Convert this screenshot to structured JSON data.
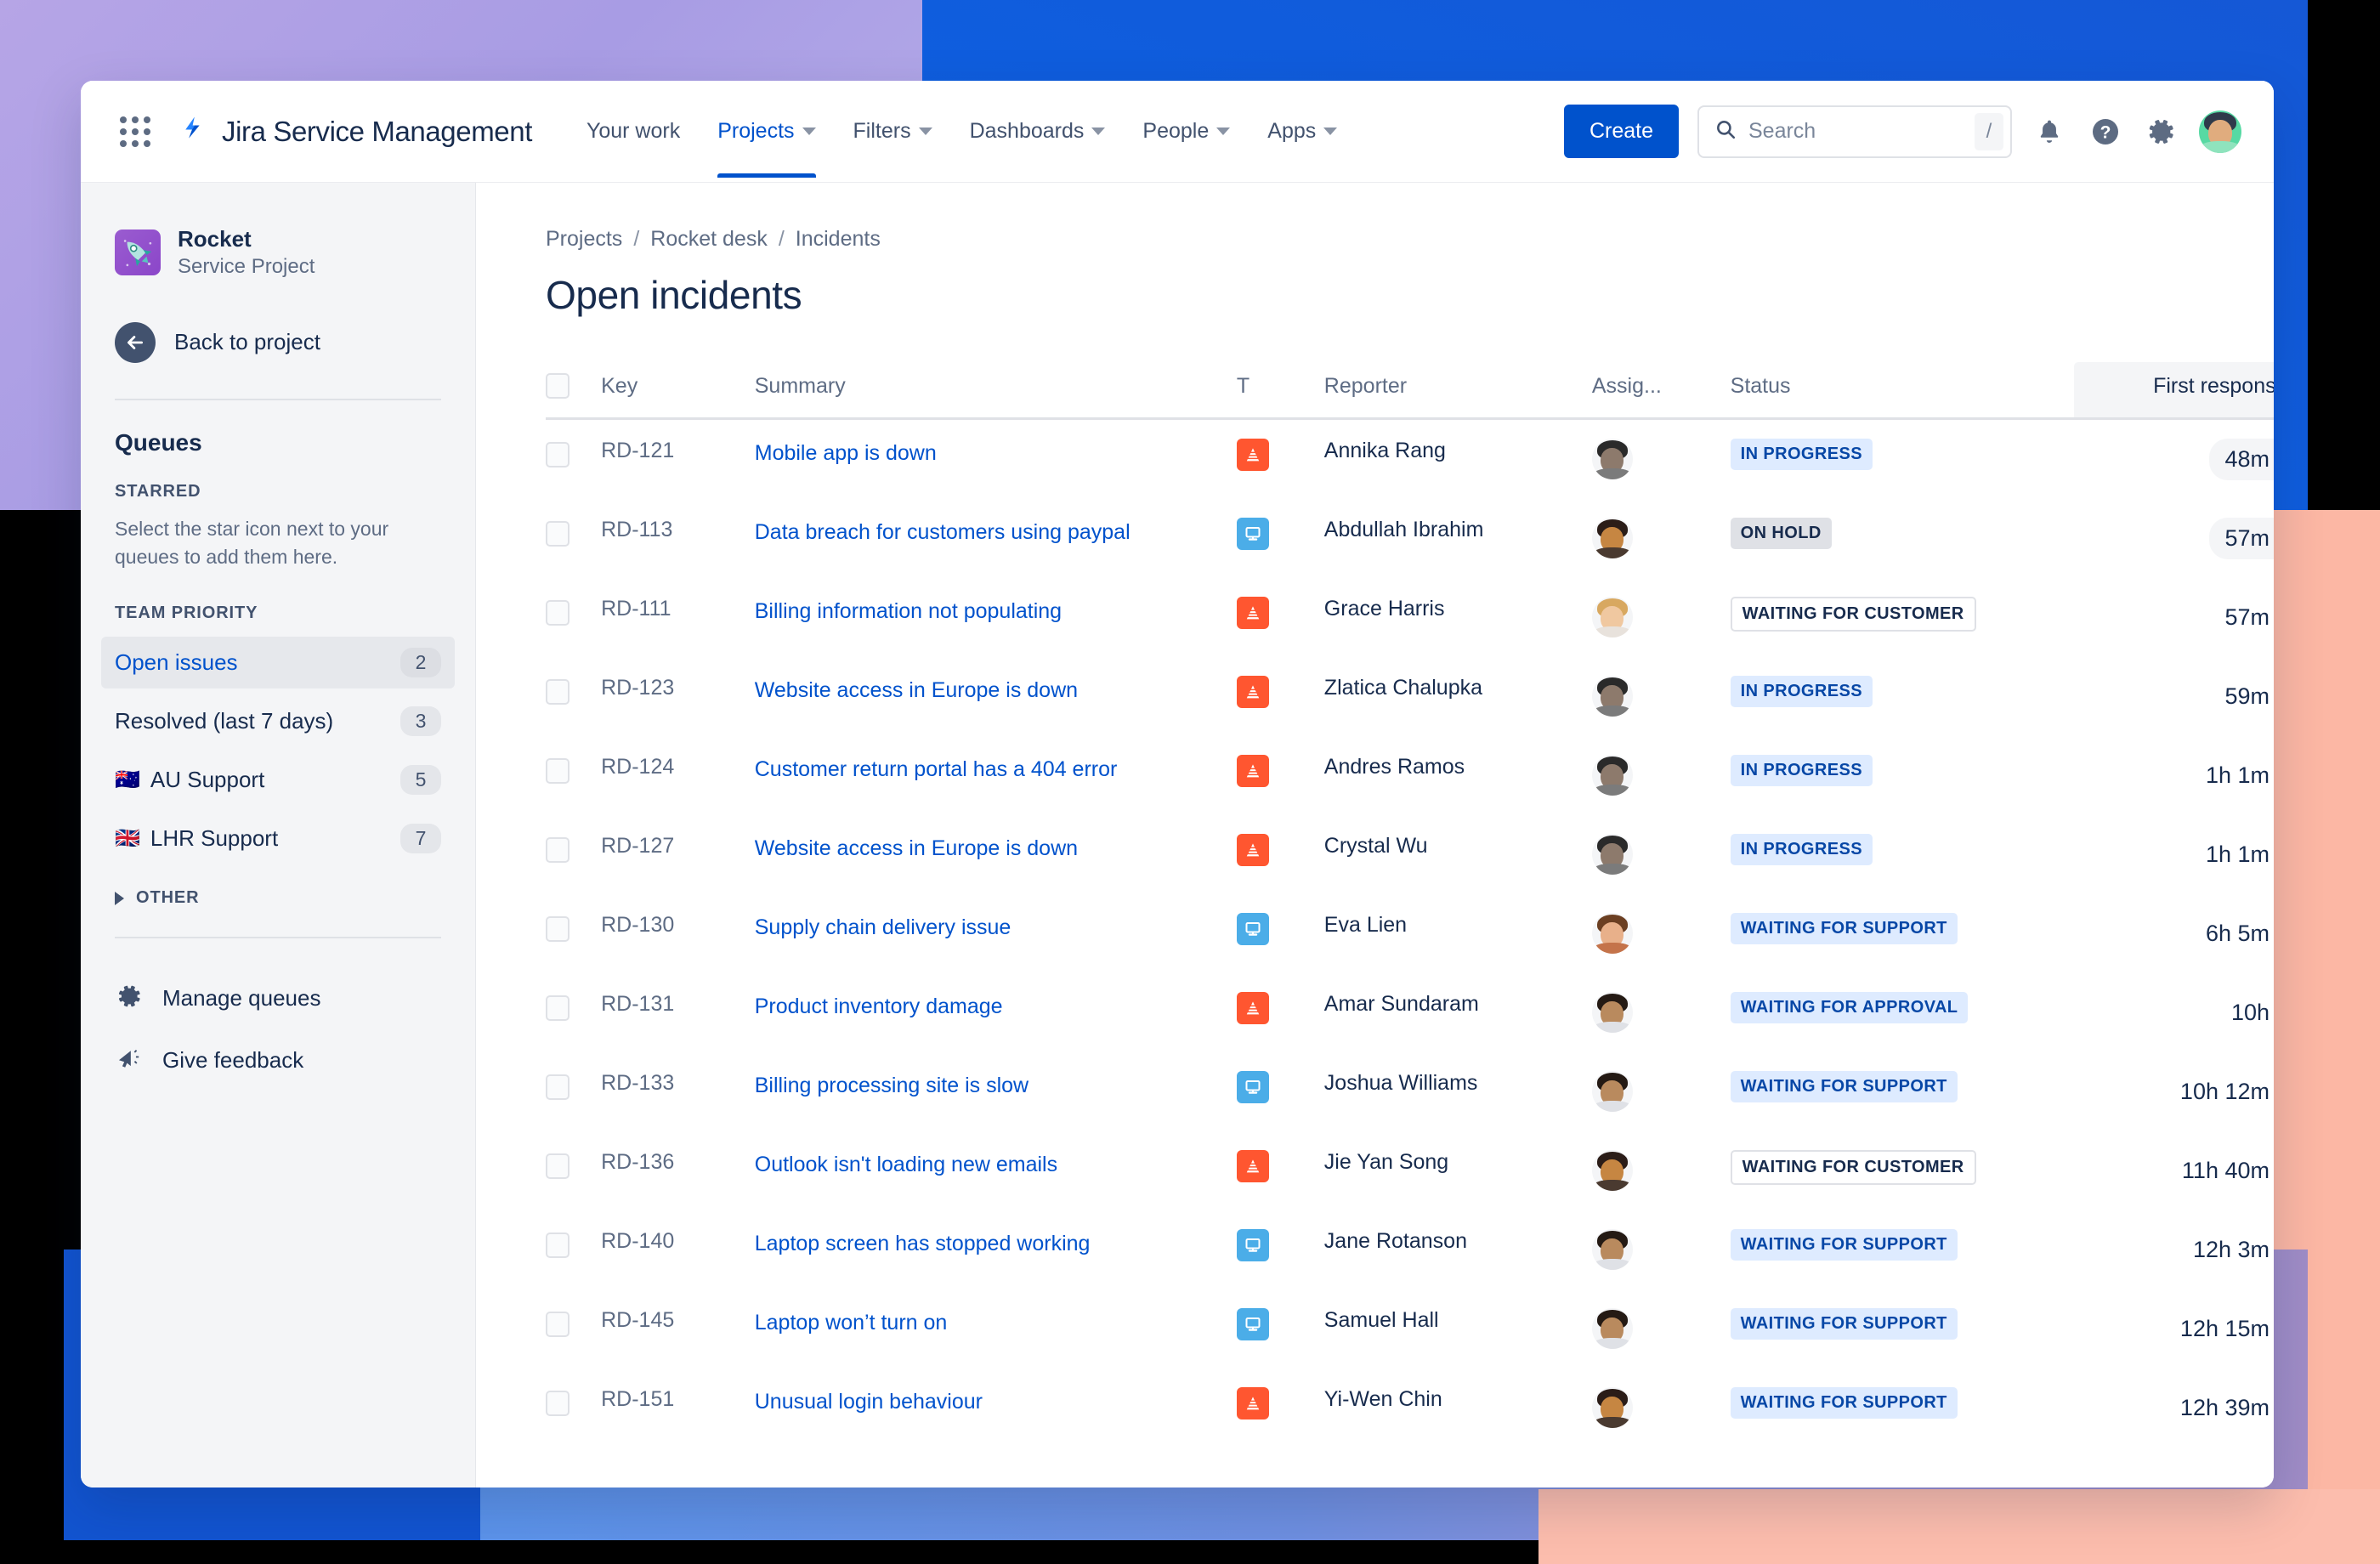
{
  "topnav": {
    "app_title": "Jira Service Management",
    "items": [
      {
        "label": "Your work",
        "has_caret": false,
        "active": false
      },
      {
        "label": "Projects",
        "has_caret": true,
        "active": true
      },
      {
        "label": "Filters",
        "has_caret": true,
        "active": false
      },
      {
        "label": "Dashboards",
        "has_caret": true,
        "active": false
      },
      {
        "label": "People",
        "has_caret": true,
        "active": false
      },
      {
        "label": "Apps",
        "has_caret": true,
        "active": false
      }
    ],
    "create_label": "Create",
    "search_placeholder": "Search",
    "search_value": "",
    "search_shortcut": "/",
    "icons": [
      "apps-grid-icon",
      "jira-logo-icon",
      "search-icon",
      "notifications-bell-icon",
      "help-icon",
      "settings-gear-icon",
      "user-avatar"
    ]
  },
  "sidebar": {
    "project_name": "Rocket",
    "project_type": "Service Project",
    "back_label": "Back to project",
    "queues_title": "Queues",
    "starred_label": "STARRED",
    "starred_hint": "Select the star icon next to your queues to add them here.",
    "team_priority_label": "TEAM PRIORITY",
    "queues": [
      {
        "label": "Open issues",
        "count": "2",
        "flag": "",
        "selected": true
      },
      {
        "label": "Resolved (last 7 days)",
        "count": "3",
        "flag": "",
        "selected": false
      },
      {
        "label": "AU Support",
        "count": "5",
        "flag": "🇦🇺",
        "selected": false
      },
      {
        "label": "LHR Support",
        "count": "7",
        "flag": "🇬🇧",
        "selected": false
      }
    ],
    "other_label": "OTHER",
    "manage_queues_label": "Manage queues",
    "give_feedback_label": "Give feedback"
  },
  "main": {
    "breadcrumb": [
      "Projects",
      "Rocket desk",
      "Incidents"
    ],
    "page_title": "Open incidents",
    "columns": {
      "key": "Key",
      "summary": "Summary",
      "type": "T",
      "reporter": "Reporter",
      "assignee": "Assig...",
      "status": "Status",
      "first_response": "First response",
      "sort_indicator": "↑"
    },
    "rows": [
      {
        "key": "RD-121",
        "summary": "Mobile app is down",
        "type": "incident",
        "reporter": "Annika Rang",
        "status": "IN PROGRESS",
        "status_style": "blue",
        "response": "48m",
        "response_state": "met",
        "avatar": {
          "hair": "#2a2a2a",
          "skin": "#8d7a6c",
          "body": "#7b7b7b"
        }
      },
      {
        "key": "RD-113",
        "summary": "Data breach for customers using paypal",
        "type": "request",
        "reporter": "Abdullah Ibrahim",
        "status": "ON HOLD",
        "status_style": "grey",
        "response": "57m",
        "response_state": "met",
        "avatar": {
          "hair": "#2b1d18",
          "skin": "#c68642",
          "body": "#4a3a30"
        }
      },
      {
        "key": "RD-111",
        "summary": "Billing information not populating",
        "type": "incident",
        "reporter": "Grace Harris",
        "status": "WAITING FOR CUSTOMER",
        "status_style": "outline",
        "response": "57m",
        "response_state": "pending",
        "avatar": {
          "hair": "#d8a860",
          "skin": "#f0c8a0",
          "body": "#e8e2dc"
        }
      },
      {
        "key": "RD-123",
        "summary": "Website access in Europe is down",
        "type": "incident",
        "reporter": "Zlatica Chalupka",
        "status": "IN PROGRESS",
        "status_style": "blue",
        "response": "59m",
        "response_state": "pending",
        "avatar": {
          "hair": "#2a2a2a",
          "skin": "#8d7a6c",
          "body": "#7b7b7b"
        }
      },
      {
        "key": "RD-124",
        "summary": "Customer return portal has a 404 error",
        "type": "incident",
        "reporter": "Andres Ramos",
        "status": "IN PROGRESS",
        "status_style": "blue",
        "response": "1h 1m",
        "response_state": "pending",
        "avatar": {
          "hair": "#2a2a2a",
          "skin": "#8d7a6c",
          "body": "#7b7b7b"
        }
      },
      {
        "key": "RD-127",
        "summary": "Website access in Europe is down",
        "type": "incident",
        "reporter": "Crystal Wu",
        "status": "IN PROGRESS",
        "status_style": "blue",
        "response": "1h 1m",
        "response_state": "pending",
        "avatar": {
          "hair": "#2a2a2a",
          "skin": "#8d7a6c",
          "body": "#7b7b7b"
        }
      },
      {
        "key": "RD-130",
        "summary": "Supply chain delivery issue",
        "type": "request",
        "reporter": "Eva Lien",
        "status": "WAITING FOR SUPPORT",
        "status_style": "blue",
        "response": "6h 5m",
        "response_state": "pending",
        "avatar": {
          "hair": "#6b3f22",
          "skin": "#e8b08a",
          "body": "#c4734a"
        }
      },
      {
        "key": "RD-131",
        "summary": "Product inventory damage",
        "type": "incident",
        "reporter": "Amar Sundaram",
        "status": "WAITING FOR APPROVAL",
        "status_style": "blue",
        "response": "10h",
        "response_state": "pending",
        "avatar": {
          "hair": "#241a14",
          "skin": "#b98a5e",
          "body": "#dfe1e6"
        }
      },
      {
        "key": "RD-133",
        "summary": "Billing processing site is slow",
        "type": "request",
        "reporter": "Joshua Williams",
        "status": "WAITING FOR SUPPORT",
        "status_style": "blue",
        "response": "10h 12m",
        "response_state": "pending",
        "avatar": {
          "hair": "#241a14",
          "skin": "#b98a5e",
          "body": "#dfe1e6"
        }
      },
      {
        "key": "RD-136",
        "summary": "Outlook isn't loading new emails",
        "type": "incident",
        "reporter": "Jie Yan Song",
        "status": "WAITING FOR CUSTOMER",
        "status_style": "outline",
        "response": "11h 40m",
        "response_state": "pending",
        "avatar": {
          "hair": "#2b1d18",
          "skin": "#c68642",
          "body": "#4a3a30"
        }
      },
      {
        "key": "RD-140",
        "summary": "Laptop screen has stopped working",
        "type": "request",
        "reporter": "Jane Rotanson",
        "status": "WAITING FOR SUPPORT",
        "status_style": "blue",
        "response": "12h 3m",
        "response_state": "pending",
        "avatar": {
          "hair": "#241a14",
          "skin": "#b98a5e",
          "body": "#dfe1e6"
        }
      },
      {
        "key": "RD-145",
        "summary": "Laptop won’t turn on",
        "type": "request",
        "reporter": "Samuel Hall",
        "status": "WAITING FOR SUPPORT",
        "status_style": "blue",
        "response": "12h 15m",
        "response_state": "pending",
        "avatar": {
          "hair": "#241a14",
          "skin": "#b98a5e",
          "body": "#dfe1e6"
        }
      },
      {
        "key": "RD-151",
        "summary": "Unusual login behaviour",
        "type": "incident",
        "reporter": "Yi-Wen Chin",
        "status": "WAITING FOR SUPPORT",
        "status_style": "blue",
        "response": "12h 39m",
        "response_state": "pending",
        "avatar": {
          "hair": "#2b1d18",
          "skin": "#c68642",
          "body": "#4a3a30"
        }
      }
    ]
  },
  "colors": {
    "brand_blue": "#0052cc",
    "link_blue": "#0052cc",
    "text_dark": "#172b4d",
    "text_muted": "#5e6c84",
    "incident_orange": "#ff5630",
    "request_blue": "#4bade8",
    "badge_blue_bg": "#deebff",
    "badge_blue_text": "#0747a6",
    "sla_met_green": "#36b37e"
  }
}
